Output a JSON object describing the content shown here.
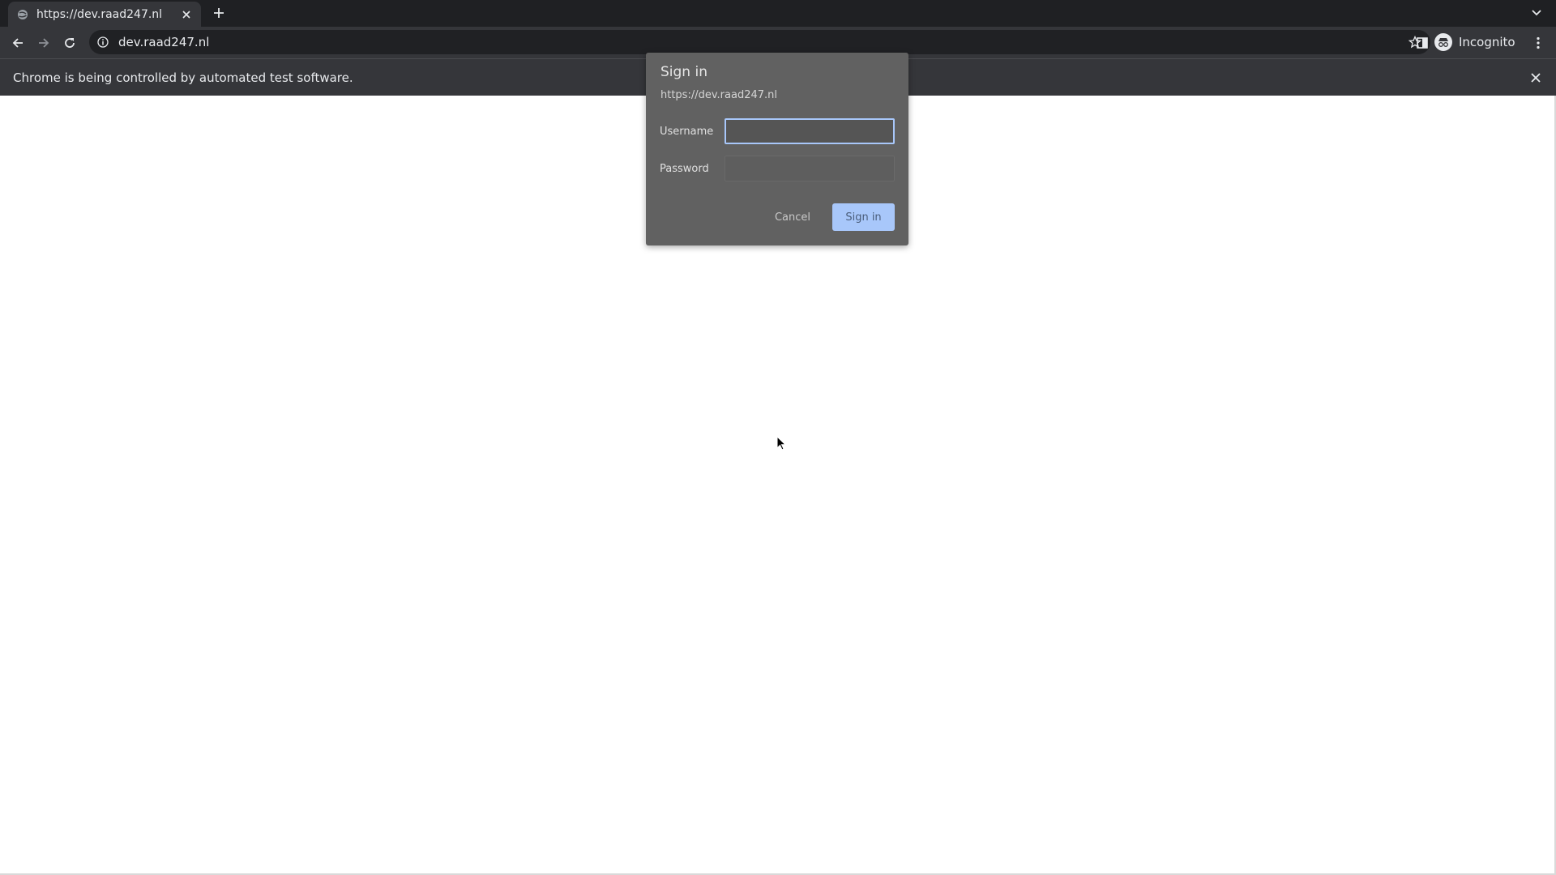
{
  "browser": {
    "tab": {
      "title": "https://dev.raad247.nl"
    },
    "omnibox": {
      "url": "dev.raad247.nl"
    },
    "profile": {
      "label": "Incognito"
    },
    "infobar": {
      "message": "Chrome is being controlled by automated test software."
    }
  },
  "dialog": {
    "title": "Sign in",
    "origin": "https://dev.raad247.nl",
    "username_label": "Username",
    "username_value": "",
    "password_label": "Password",
    "password_value": "",
    "cancel_label": "Cancel",
    "signin_label": "Sign in"
  },
  "colors": {
    "browser_frame": "#35363a",
    "tab_strip": "#1f2023",
    "dialog_bg": "#616161",
    "accent": "#a8c7fa"
  },
  "icons": [
    "globe-icon",
    "close-icon",
    "plus-icon",
    "chevron-down-icon",
    "back-arrow-icon",
    "forward-arrow-icon",
    "reload-icon",
    "info-icon",
    "star-icon",
    "side-panel-icon",
    "incognito-icon",
    "kebab-menu-icon",
    "mouse-cursor-icon"
  ]
}
